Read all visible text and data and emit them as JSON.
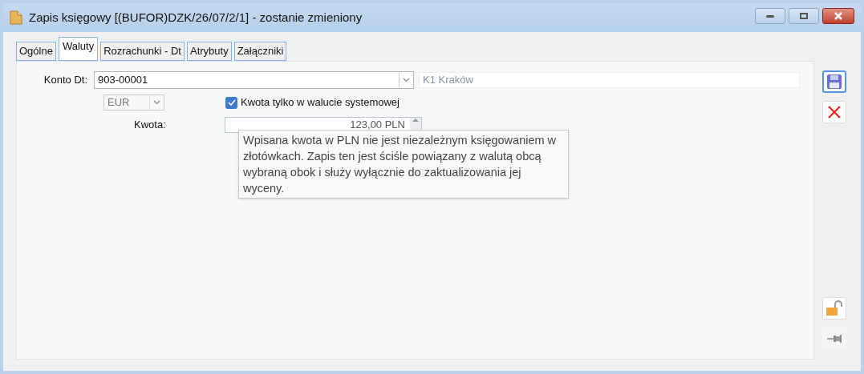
{
  "window": {
    "title": "Zapis księgowy [(BUFOR)DZK/26/07/2/1] - zostanie zmieniony"
  },
  "tabs": [
    {
      "label": "Ogólne",
      "selected": false
    },
    {
      "label": "Waluty",
      "selected": true
    },
    {
      "label": "Rozrachunki - Dt",
      "selected": false
    },
    {
      "label": "Atrybuty",
      "selected": false
    },
    {
      "label": "Załączniki",
      "selected": false
    }
  ],
  "form": {
    "account_label": "Konto Dt:",
    "account_value": "903-00001",
    "account_name": "K1 Kraków",
    "currency": "EUR",
    "system_currency_only": {
      "label": "Kwota tylko w walucie systemowej",
      "checked": true
    },
    "amount_label": "Kwota:",
    "amount_value": "123,00 PLN"
  },
  "tooltip": "Wpisana kwota w PLN nie jest niezależnym księgowaniem w złotówkach. Zapis ten jest ściśle powiązany z walutą obcą wybraną obok i służy wyłącznie do zaktualizowania jej wyceny."
}
